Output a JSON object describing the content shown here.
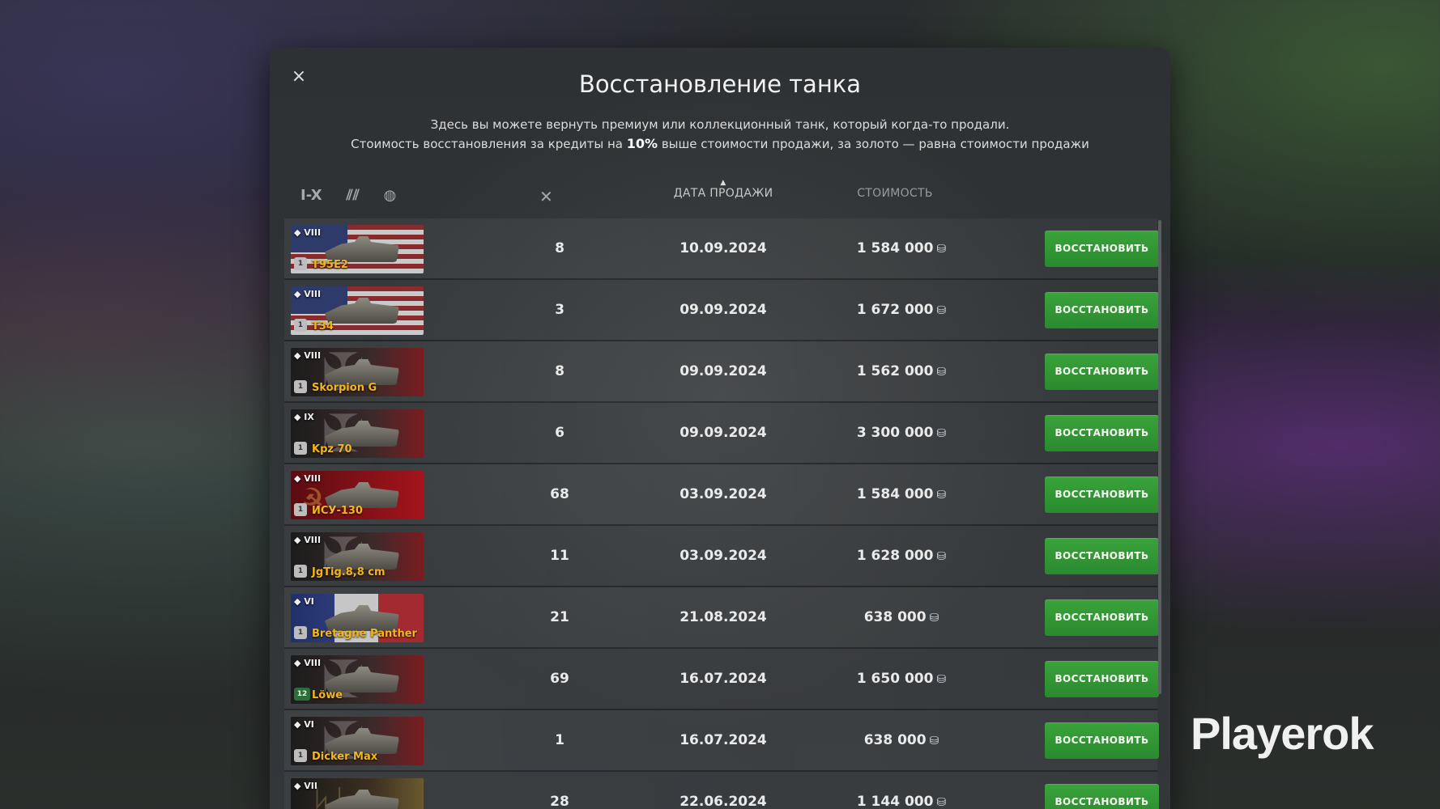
{
  "modal": {
    "title": "Восстановление танка",
    "desc_line1": "Здесь вы можете вернуть премиум или коллекционный танк, который когда-то продали.",
    "desc_line2_a": "Стоимость восстановления за кредиты на ",
    "desc_line2_b": "10%",
    "desc_line2_c": " выше стоимости продажи, за золото — равна стоимости продажи",
    "close_icon": "×"
  },
  "filters": {
    "tier": "I-X",
    "type_icon": "vehicle-type-icon",
    "nation_icon": "globe-icon"
  },
  "columns": {
    "battles_icon": "crossed-swords-icon",
    "date": "ДАТА ПРОДАЖИ",
    "date_sort": "▲",
    "cost": "СТОИМОСТЬ"
  },
  "button_label": "ВОССТАНОВИТЬ",
  "rows": [
    {
      "tier": "VIII",
      "name": "T95E2",
      "mastery": "1",
      "battles": "8",
      "date": "10.09.2024",
      "cost": "1 584 000",
      "nation": "usa"
    },
    {
      "tier": "VIII",
      "name": "T34",
      "mastery": "1",
      "battles": "3",
      "date": "09.09.2024",
      "cost": "1 672 000",
      "nation": "usa"
    },
    {
      "tier": "VIII",
      "name": "Skorpion G",
      "mastery": "1",
      "battles": "8",
      "date": "09.09.2024",
      "cost": "1 562 000",
      "nation": "ger"
    },
    {
      "tier": "IX",
      "name": "Kpz 70",
      "mastery": "1",
      "battles": "6",
      "date": "09.09.2024",
      "cost": "3 300 000",
      "nation": "ger"
    },
    {
      "tier": "VIII",
      "name": "ИСУ-130",
      "mastery": "1",
      "battles": "68",
      "date": "03.09.2024",
      "cost": "1 584 000",
      "nation": "ussr"
    },
    {
      "tier": "VIII",
      "name": "JgTig.8,8 cm",
      "mastery": "1",
      "battles": "11",
      "date": "03.09.2024",
      "cost": "1 628 000",
      "nation": "ger"
    },
    {
      "tier": "VI",
      "name": "Bretagne Panther",
      "mastery": "1",
      "battles": "21",
      "date": "21.08.2024",
      "cost": "638 000",
      "nation": "fra"
    },
    {
      "tier": "VIII",
      "name": "Löwe",
      "mastery": "12",
      "battles": "69",
      "date": "16.07.2024",
      "cost": "1 650 000",
      "nation": "ger"
    },
    {
      "tier": "VI",
      "name": "Dicker Max",
      "mastery": "1",
      "battles": "1",
      "date": "16.07.2024",
      "cost": "638 000",
      "nation": "ger"
    },
    {
      "tier": "VII",
      "name": "",
      "mastery": "",
      "battles": "28",
      "date": "22.06.2024",
      "cost": "1 144 000",
      "nation": "ger2"
    }
  ],
  "watermark": "Playerok"
}
